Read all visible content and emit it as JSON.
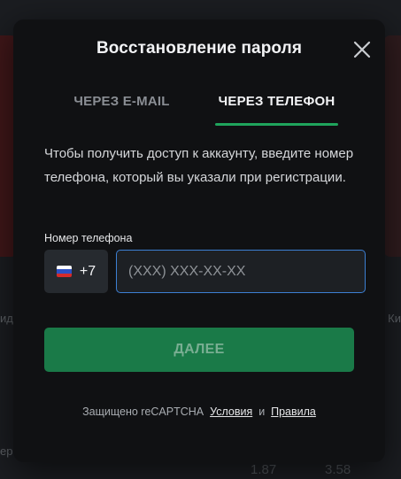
{
  "dialog": {
    "title": "Восстановление пароля"
  },
  "tabs": [
    {
      "label": "ЧЕРЕЗ E-MAIL",
      "active": false
    },
    {
      "label": "ЧЕРЕЗ ТЕЛЕФОН",
      "active": true
    }
  ],
  "description": "Чтобы получить доступ к аккаунту, введите номер телефона, который вы указали при регистрации.",
  "phone": {
    "label": "Номер телефона",
    "country_code": "+7",
    "country_flag": "russia-flag-icon",
    "placeholder": "(XXX) XXX-XX-XX",
    "value": ""
  },
  "submit_label": "ДАЛЕЕ",
  "recaptcha": {
    "prefix": "Защищено reCAPTCHA",
    "terms_label": "Условия",
    "and_text": "и",
    "privacy_label": "Правила"
  },
  "background": {
    "left_text": "ид",
    "right_text": "Ки",
    "bottom_left_text": "ер",
    "odds": [
      "1.87",
      "3.58"
    ]
  },
  "colors": {
    "accent": "#1fa45c",
    "button_bg": "#1a7a48",
    "input_focus": "#3c7fd3",
    "modal_bg": "#101113"
  }
}
